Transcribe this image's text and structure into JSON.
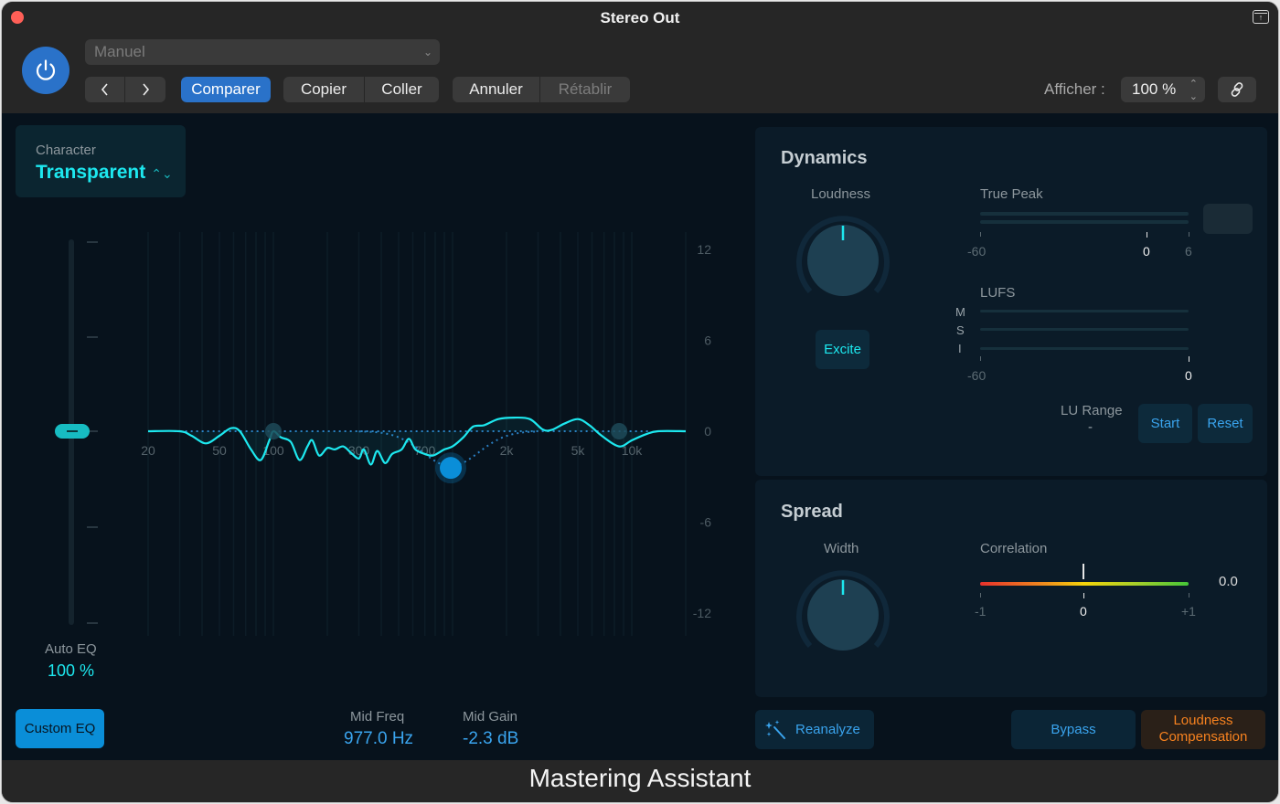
{
  "window": {
    "title": "Stereo Out",
    "footer_title": "Mastering Assistant"
  },
  "toolbar": {
    "preset": "Manuel",
    "prev_label": "<",
    "next_label": ">",
    "compare": "Comparer",
    "copy": "Copier",
    "paste": "Coller",
    "undo": "Annuler",
    "redo": "Rétablir",
    "view_label": "Afficher :",
    "view_value": "100 %"
  },
  "eq": {
    "character_label": "Character",
    "character_value": "Transparent",
    "auto_eq_label": "Auto EQ",
    "auto_eq_value": "100 %",
    "auto_eq_fraction": 1.0,
    "custom_eq_label": "Custom EQ",
    "mid_freq_label": "Mid Freq",
    "mid_freq_value": "977.0 Hz",
    "mid_gain_label": "Mid Gain",
    "mid_gain_value": "-2.3 dB",
    "freq_ticks": [
      "20",
      "50",
      "100",
      "300",
      "700",
      "2k",
      "5k",
      "10k"
    ],
    "freq_tick_hz": [
      20,
      50,
      100,
      300,
      700,
      2000,
      5000,
      10000
    ],
    "gain_ticks": [
      "12",
      "6",
      "0",
      "-6",
      "-12"
    ],
    "gain_tick_db": [
      12,
      6,
      0,
      -6,
      -12
    ],
    "colors": {
      "curve": "#1de8ef",
      "handle": "#0a8ed8",
      "dotted": "#2a7fc2"
    },
    "nodes": [
      {
        "name": "low",
        "hz": 100,
        "db": 0,
        "active": false
      },
      {
        "name": "mid",
        "hz": 977,
        "db": -2.3,
        "active": true
      },
      {
        "name": "high",
        "hz": 8500,
        "db": 0,
        "active": false
      }
    ],
    "curve_points": [
      [
        20,
        0
      ],
      [
        30,
        0
      ],
      [
        35,
        -0.3
      ],
      [
        42,
        -0.8
      ],
      [
        50,
        -0.3
      ],
      [
        58,
        0.2
      ],
      [
        65,
        0
      ],
      [
        75,
        -1.2
      ],
      [
        85,
        -1.9
      ],
      [
        95,
        -0.6
      ],
      [
        100,
        0
      ],
      [
        110,
        -0.4
      ],
      [
        125,
        -0.7
      ],
      [
        140,
        -1.9
      ],
      [
        155,
        -1
      ],
      [
        165,
        -0.6
      ],
      [
        180,
        -1.6
      ],
      [
        200,
        -1.1
      ],
      [
        220,
        -1.2
      ],
      [
        245,
        -1
      ],
      [
        270,
        -1.4
      ],
      [
        300,
        -1.8
      ],
      [
        320,
        -1.2
      ],
      [
        350,
        -2.2
      ],
      [
        380,
        -1.3
      ],
      [
        420,
        -2.1
      ],
      [
        460,
        -1.5
      ],
      [
        520,
        -1.2
      ],
      [
        570,
        -0.5
      ],
      [
        620,
        -1.2
      ],
      [
        700,
        -1.5
      ],
      [
        780,
        -1.6
      ],
      [
        900,
        -1.2
      ],
      [
        1000,
        -1.0
      ],
      [
        1150,
        -0.4
      ],
      [
        1300,
        0.3
      ],
      [
        1500,
        0.4
      ],
      [
        1800,
        0.8
      ],
      [
        2200,
        0.9
      ],
      [
        2700,
        0.8
      ],
      [
        3200,
        0.1
      ],
      [
        3600,
        0.1
      ],
      [
        4200,
        0.5
      ],
      [
        5000,
        0.8
      ],
      [
        5800,
        0.4
      ],
      [
        6800,
        -0.3
      ],
      [
        8500,
        -1.0
      ],
      [
        10000,
        -0.6
      ],
      [
        12000,
        -0.2
      ],
      [
        14000,
        0
      ],
      [
        20000,
        0
      ]
    ]
  },
  "dynamics": {
    "title": "Dynamics",
    "loudness_label": "Loudness",
    "loudness_value": 0.5,
    "excite_label": "Excite",
    "true_peak_label": "True Peak",
    "true_peak_scale": [
      "-60",
      "0",
      "6"
    ],
    "lufs_label": "LUFS",
    "lufs_rows": [
      "M",
      "S",
      "I"
    ],
    "lufs_scale": [
      "-60",
      "0"
    ],
    "lu_range_label": "LU Range",
    "lu_range_value": "-",
    "start_label": "Start",
    "reset_label": "Reset"
  },
  "spread": {
    "title": "Spread",
    "width_label": "Width",
    "width_value": 0.5,
    "correlation_label": "Correlation",
    "correlation_scale": [
      "-1",
      "0",
      "+1"
    ],
    "correlation_value": "0.0"
  },
  "footer_buttons": {
    "reanalyze": "Reanalyze",
    "bypass": "Bypass",
    "loudness_comp_line1": "Loudness",
    "loudness_comp_line2": "Compensation"
  }
}
